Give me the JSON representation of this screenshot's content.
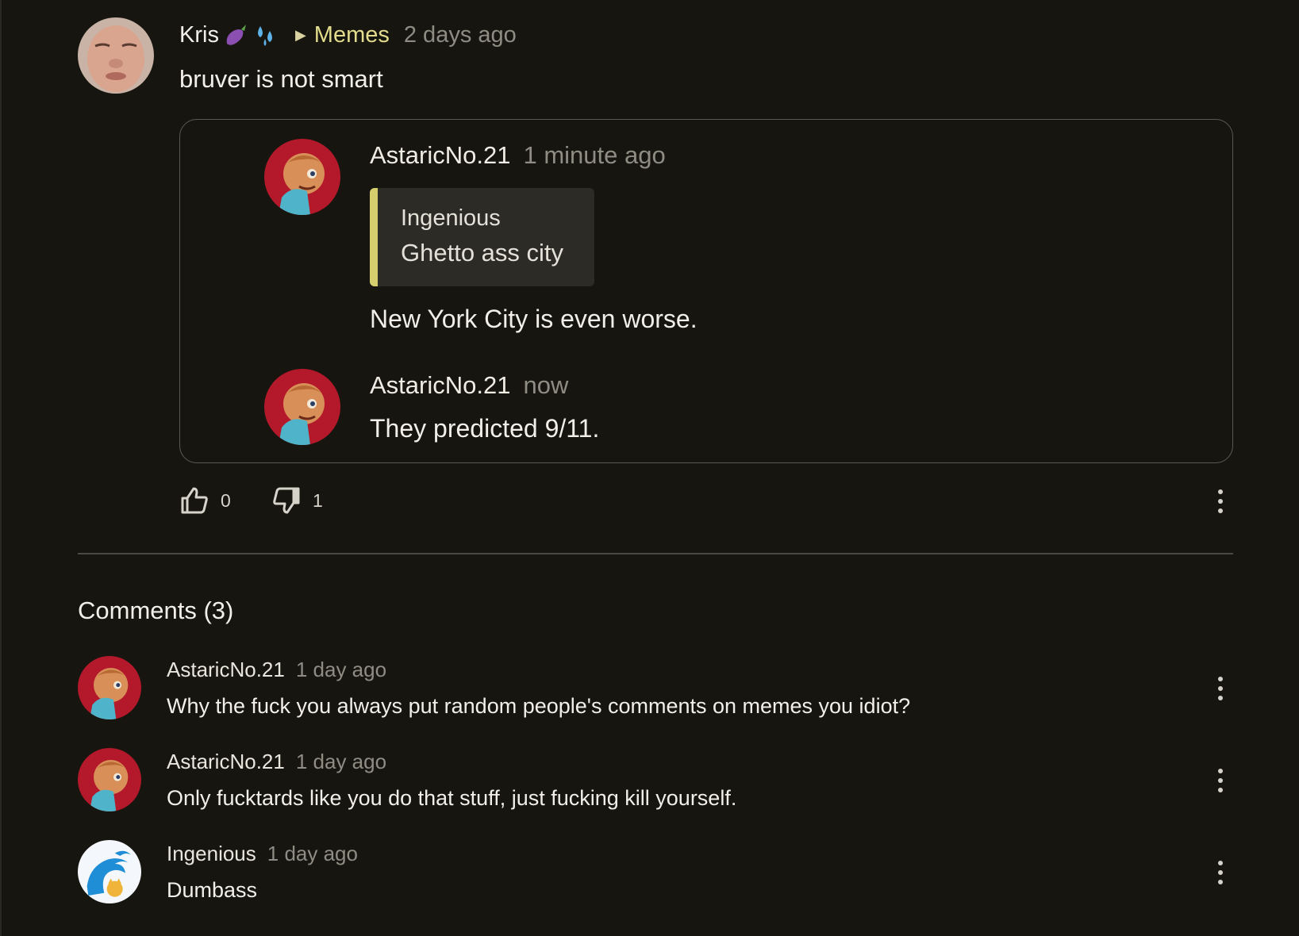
{
  "post": {
    "author": "Kris",
    "author_emojis": [
      "eggplant-emoji",
      "sweat-droplets-emoji"
    ],
    "community": "Memes",
    "time": "2 days ago",
    "body": "bruver is not smart"
  },
  "thread": {
    "reply1": {
      "author": "AstaricNo.21",
      "time": "1 minute ago",
      "quote": {
        "author": "Ingenious",
        "text": "Ghetto ass city"
      },
      "body": "New York City is even worse."
    },
    "reply2": {
      "author": "AstaricNo.21",
      "time": "now",
      "body": "They predicted 9/11."
    }
  },
  "votes": {
    "up": "0",
    "down": "1"
  },
  "comments": {
    "title": "Comments (3)",
    "items": [
      {
        "author": "AstaricNo.21",
        "time": "1 day ago",
        "body": "Why the fuck you always put random people's comments on memes you idiot?"
      },
      {
        "author": "AstaricNo.21",
        "time": "1 day ago",
        "body": "Only fucktards like you do that stuff, just fucking kill yourself."
      },
      {
        "author": "Ingenious",
        "time": "1 day ago",
        "body": "Dumbass"
      }
    ]
  },
  "colors": {
    "background": "#16150f",
    "accent": "#e2dc8c",
    "quote_bar": "#d6cf6e",
    "muted": "#8e8c83"
  }
}
